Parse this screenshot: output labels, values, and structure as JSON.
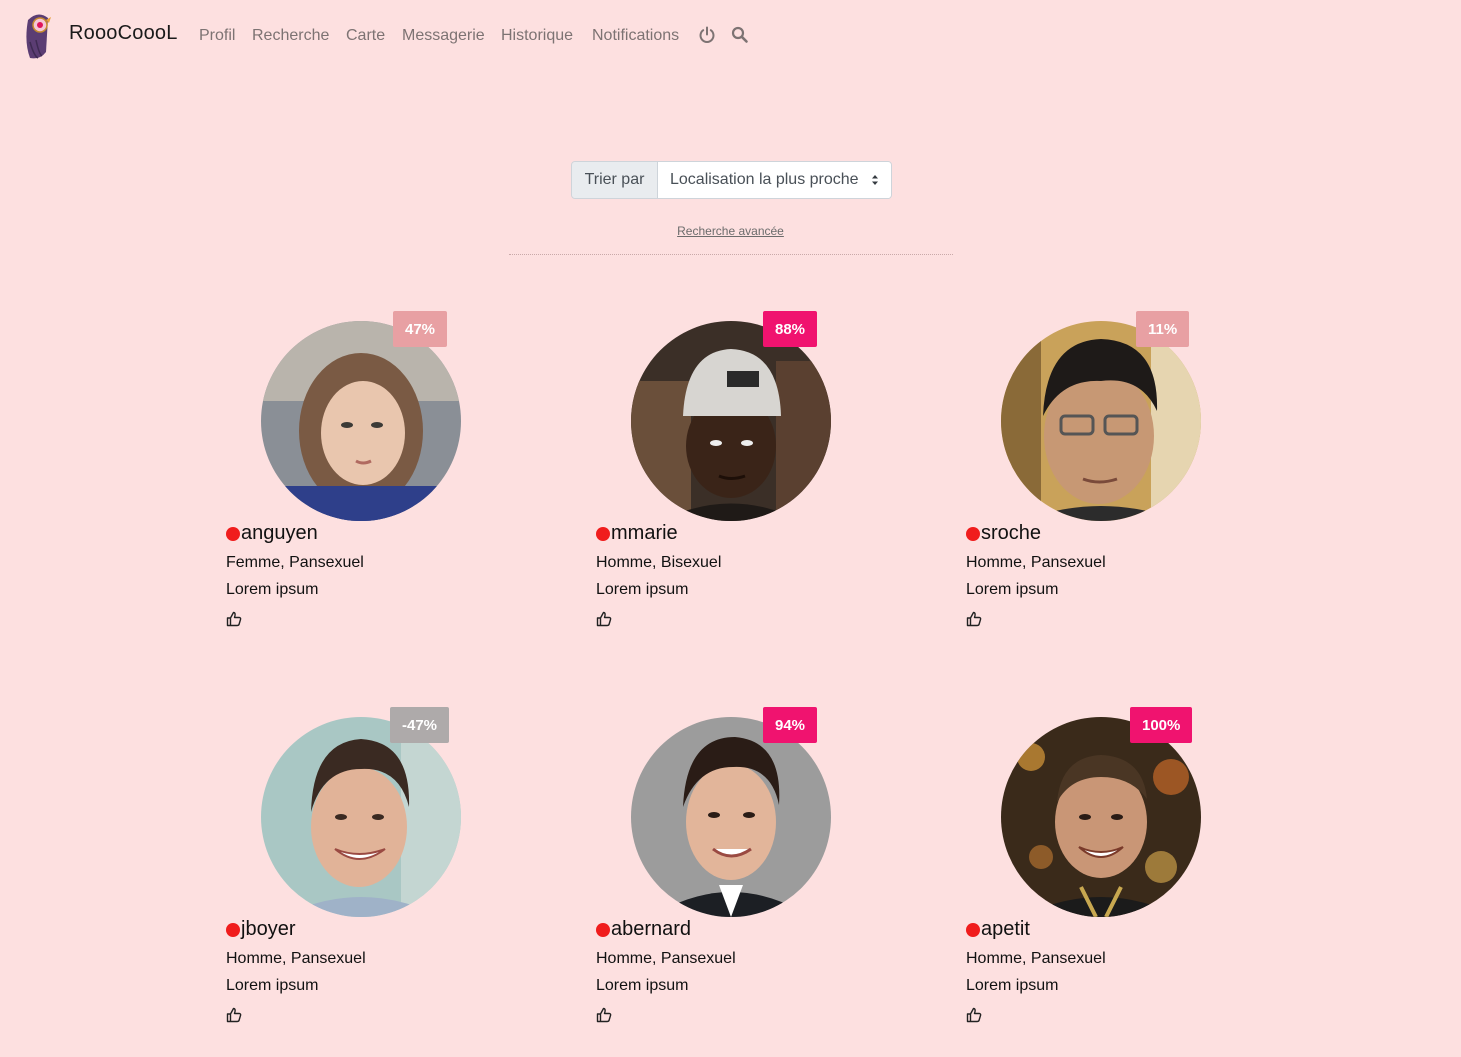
{
  "navbar": {
    "brand": "RoooCoooL",
    "items": [
      {
        "label": "Profil"
      },
      {
        "label": "Recherche"
      },
      {
        "label": "Carte"
      },
      {
        "label": "Messagerie"
      },
      {
        "label": "Historique"
      },
      {
        "label": "Notifications"
      }
    ],
    "icons": [
      "power-icon",
      "search-icon"
    ]
  },
  "sort": {
    "label": "Trier par",
    "selected": "Localisation la plus proche"
  },
  "advanced_search": "Recherche avancée",
  "profiles": [
    {
      "username": "anguyen",
      "score": "47%",
      "gender_orientation": "Femme, Pansexuel",
      "bio": "Lorem ipsum",
      "online_color": "#f01c1c",
      "badge_color": "#e8a0a3"
    },
    {
      "username": "mmarie",
      "score": "88%",
      "gender_orientation": "Homme, Bisexuel",
      "bio": "Lorem ipsum",
      "online_color": "#f01c1c",
      "badge_color": "#f0136f"
    },
    {
      "username": "sroche",
      "score": "11%",
      "gender_orientation": "Homme, Pansexuel",
      "bio": "Lorem ipsum",
      "online_color": "#f01c1c",
      "badge_color": "#e8a0a3"
    },
    {
      "username": "jboyer",
      "score": "-47%",
      "gender_orientation": "Homme, Pansexuel",
      "bio": "Lorem ipsum",
      "online_color": "#f01c1c",
      "badge_color": "#aeaaaa"
    },
    {
      "username": "abernard",
      "score": "94%",
      "gender_orientation": "Homme, Pansexuel",
      "bio": "Lorem ipsum",
      "online_color": "#f01c1c",
      "badge_color": "#f0136f"
    },
    {
      "username": "apetit",
      "score": "100%",
      "gender_orientation": "Homme, Pansexuel",
      "bio": "Lorem ipsum",
      "online_color": "#f01c1c",
      "badge_color": "#f0136f"
    }
  ],
  "colors": {
    "background": "#fde0e0",
    "nav_text": "#7d7373",
    "online": "#f01c1c"
  }
}
